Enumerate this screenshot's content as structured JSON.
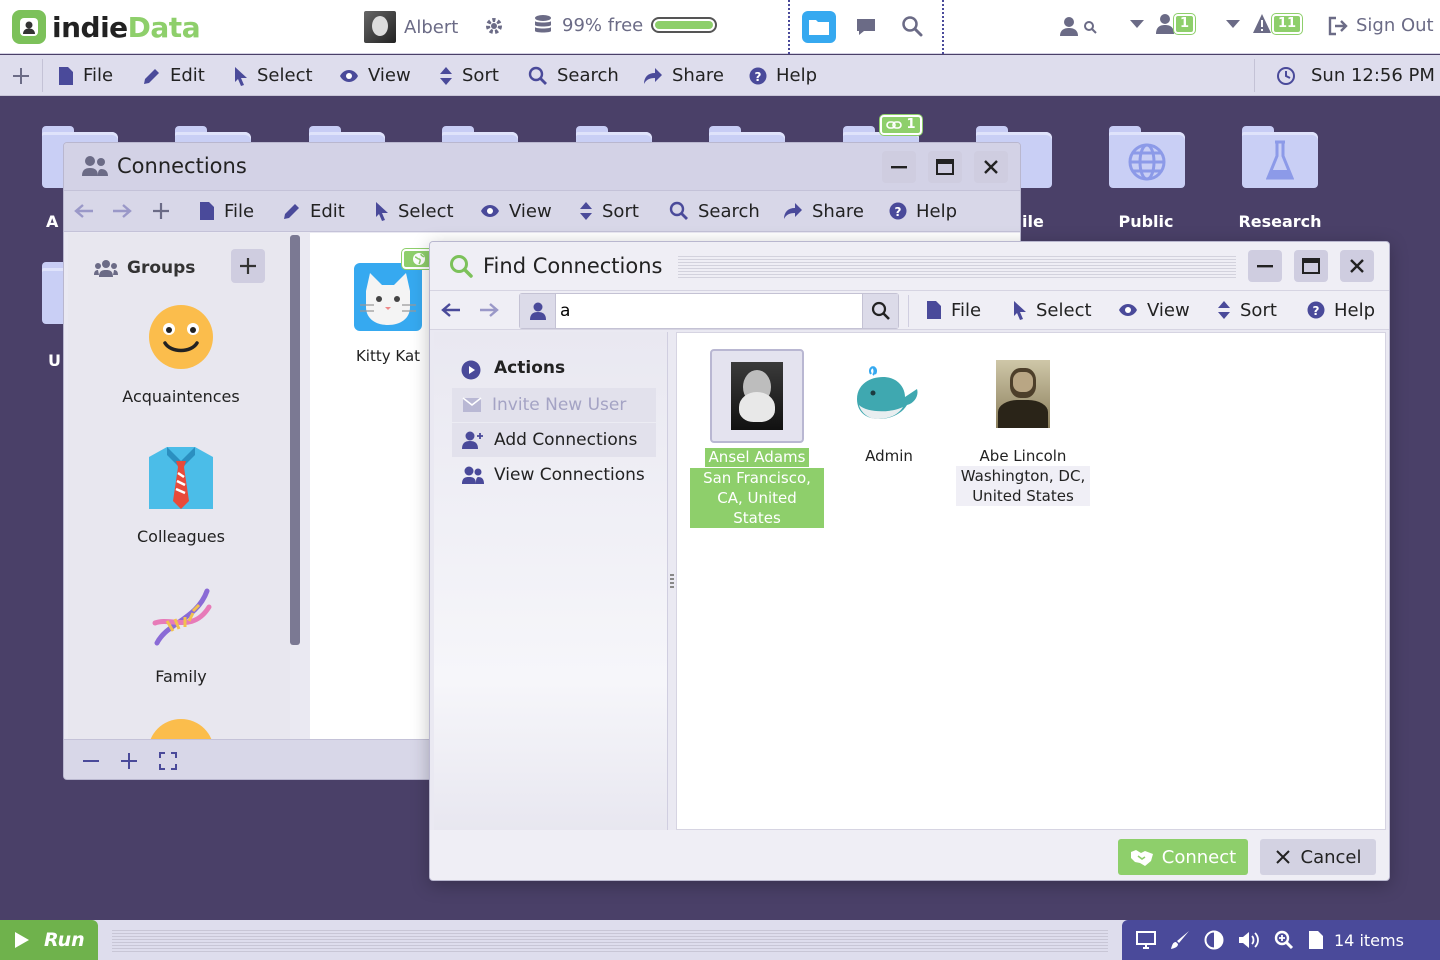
{
  "header": {
    "logo_part1": "indie",
    "logo_part2": "Data",
    "user_name": "Albert",
    "storage_text": "99% free",
    "storage_fraction": 0.99,
    "badge_people": "1",
    "badge_alerts": "11",
    "badge_links": "1",
    "sign_out": "Sign Out"
  },
  "menubar": {
    "file": "File",
    "edit": "Edit",
    "select": "Select",
    "view": "View",
    "sort": "Sort",
    "search": "Search",
    "share": "Share",
    "help": "Help",
    "clock": "Sun 12:56 PM"
  },
  "desktop": {
    "folders": [
      {
        "label": "Public",
        "icon": "globe-icon"
      },
      {
        "label": "Research",
        "icon": "flask-icon"
      }
    ],
    "partial_labels": {
      "a": "A",
      "u": "U",
      "file": "ile"
    }
  },
  "connections_window": {
    "title": "Connections",
    "toolbar": {
      "file": "File",
      "edit": "Edit",
      "select": "Select",
      "view": "View",
      "sort": "Sort",
      "search": "Search",
      "share": "Share",
      "help": "Help"
    },
    "groups_heading": "Groups",
    "groups": [
      {
        "label": "Acquaintences",
        "icon": "smiley-icon"
      },
      {
        "label": "Colleagues",
        "icon": "shirt-tie-icon"
      },
      {
        "label": "Family",
        "icon": "dna-icon"
      }
    ],
    "items": [
      {
        "label": "Kitty Kat",
        "icon": "cat-icon"
      }
    ]
  },
  "find_window": {
    "title": "Find Connections",
    "search_value": "a",
    "toolbar": {
      "file": "File",
      "select": "Select",
      "view": "View",
      "sort": "Sort",
      "help": "Help"
    },
    "actions_heading": "Actions",
    "actions": [
      {
        "label": "Invite New User",
        "enabled": false
      },
      {
        "label": "Add Connections",
        "enabled": true
      },
      {
        "label": "View Connections",
        "enabled": true
      }
    ],
    "results": [
      {
        "name": "Ansel Adams",
        "location": "San Francisco, CA, United States",
        "selected": true
      },
      {
        "name": "Admin",
        "location": "",
        "selected": false
      },
      {
        "name": "Abe Lincoln",
        "location": "Washington, DC, United States",
        "selected": false
      }
    ],
    "connect_label": "Connect",
    "cancel_label": "Cancel"
  },
  "taskbar": {
    "run_label": "Run",
    "items_count": "14 items"
  },
  "colors": {
    "accent_green": "#8ecf6b",
    "desktop": "#4a4068",
    "tray": "#4a4a9a",
    "folder_blue": "#36a9f0"
  }
}
